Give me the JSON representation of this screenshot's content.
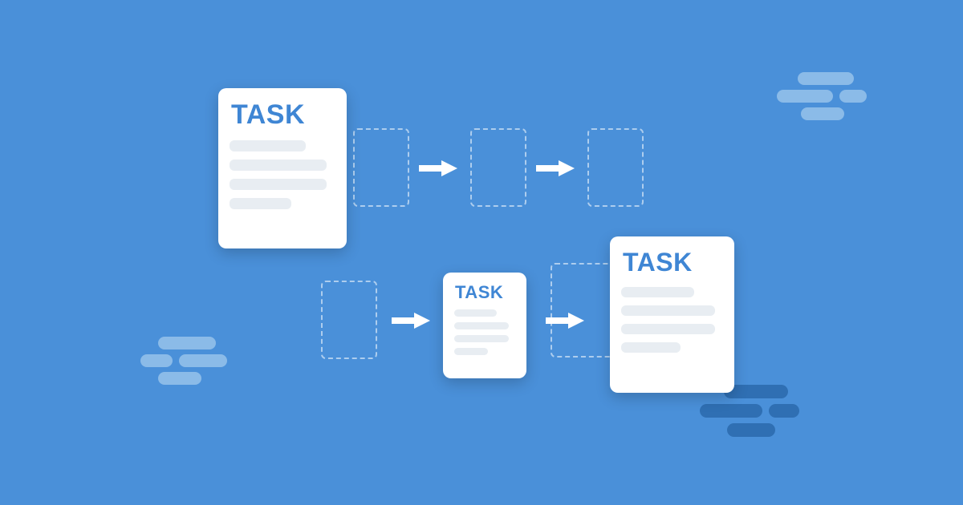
{
  "cards": {
    "large": {
      "label": "TASK"
    },
    "medium": {
      "label": "TASK"
    },
    "large2": {
      "label": "TASK"
    }
  },
  "colors": {
    "background": "#4a90d9",
    "accent_text": "#3f86d4",
    "cloud_light": "#8bbbe8",
    "cloud_dark": "#2f6fb3",
    "arrow": "#ffffff"
  }
}
